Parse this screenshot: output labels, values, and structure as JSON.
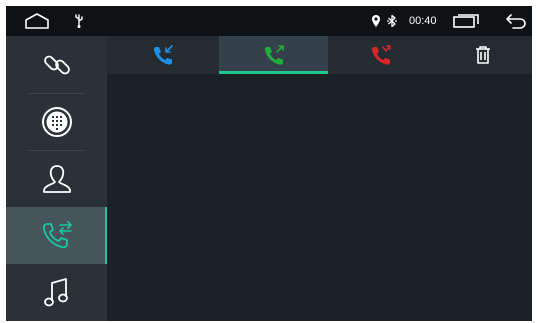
{
  "status_bar": {
    "icons": [
      "home-icon",
      "usb-icon",
      "location-icon",
      "bluetooth-icon",
      "recent-apps-icon",
      "back-icon"
    ],
    "time": "00:40"
  },
  "sidebar": {
    "items": [
      {
        "icon": "bluetooth-link-icon",
        "active": false
      },
      {
        "icon": "dialpad-icon",
        "active": false
      },
      {
        "icon": "contacts-icon",
        "active": false
      },
      {
        "icon": "call-log-icon",
        "active": true
      },
      {
        "icon": "music-icon",
        "active": false
      }
    ]
  },
  "call_log_tabs": [
    {
      "icon": "incoming-call-icon",
      "color": "#1e8fe6",
      "active": false
    },
    {
      "icon": "outgoing-call-icon",
      "color": "#1fae3a",
      "active": true
    },
    {
      "icon": "missed-call-icon",
      "color": "#d5262a",
      "active": false
    },
    {
      "icon": "delete-icon",
      "color": "#ffffff",
      "active": false
    }
  ],
  "colors": {
    "accent": "#1ec98f",
    "background": "#1b2226",
    "status_bar": "#0f1214",
    "sidebar": "#2a3237",
    "sidebar_active": "#46545b"
  }
}
